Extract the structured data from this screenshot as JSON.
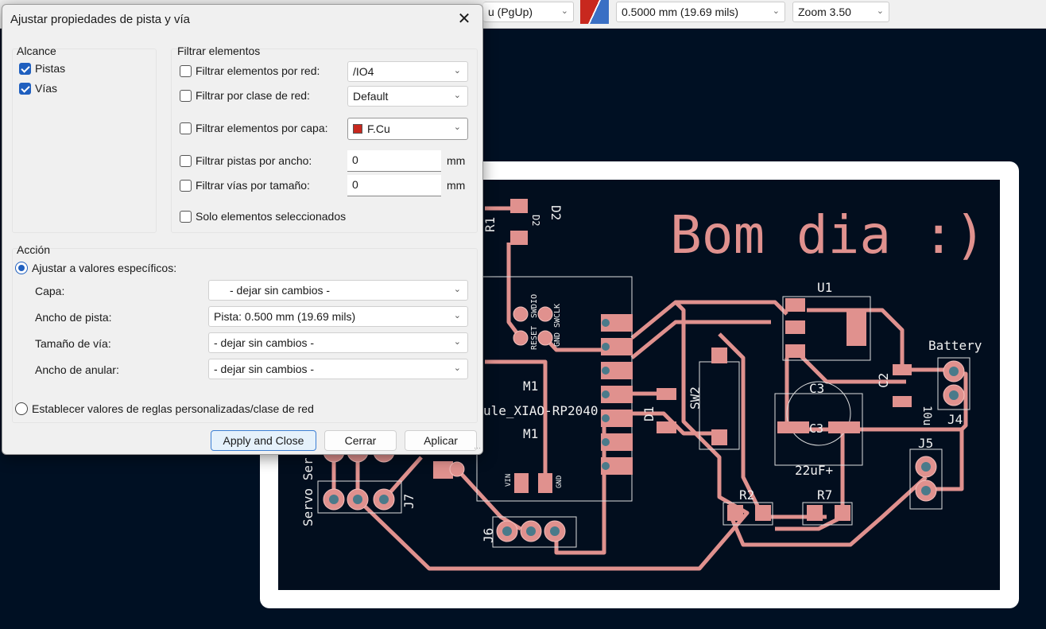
{
  "toolbar": {
    "layer_pair": "u (PgUp)",
    "track_width": "0.5000 mm (19.69 mils)",
    "zoom": "Zoom 3.50",
    "colors": {
      "front": "#c8281e",
      "back": "#3a6fc4"
    }
  },
  "dialog": {
    "title": "Ajustar propiedades de pista y vía",
    "close_icon": "close-icon",
    "scope": {
      "title": "Alcance",
      "tracks": {
        "label": "Pistas",
        "checked": true
      },
      "vias": {
        "label": "Vías",
        "checked": true
      }
    },
    "filter": {
      "title": "Filtrar elementos",
      "by_net": {
        "label": "Filtrar elementos por red:",
        "checked": false,
        "value": "/IO4"
      },
      "by_netclass": {
        "label": "Filtrar por clase de red:",
        "checked": false,
        "value": "Default"
      },
      "by_layer": {
        "label": "Filtrar elementos por capa:",
        "checked": false,
        "value": "F.Cu",
        "color": "#c8281e"
      },
      "by_track_width": {
        "label": "Filtrar pistas por ancho:",
        "checked": false,
        "value": "0",
        "unit": "mm"
      },
      "by_via_size": {
        "label": "Filtrar vías por tamaño:",
        "checked": false,
        "value": "0",
        "unit": "mm"
      },
      "selected_only": {
        "label": "Solo elementos seleccionados",
        "checked": false
      }
    },
    "action": {
      "title": "Acción",
      "set_specific": {
        "label": "Ajustar a valores específicos:",
        "selected": true
      },
      "layer": {
        "label": "Capa:",
        "value": "- dejar sin cambios -"
      },
      "track_width": {
        "label": "Ancho de pista:",
        "value": "Pista: 0.500 mm (19.69 mils)"
      },
      "via_size": {
        "label": "Tamaño de vía:",
        "value": "- dejar sin cambios -"
      },
      "annular": {
        "label": "Ancho de anular:",
        "value": "- dejar sin cambios -"
      },
      "set_netclass": {
        "label": "Establecer valores de reglas personalizadas/clase de red",
        "selected": false
      }
    },
    "buttons": {
      "apply_close": "Apply and Close",
      "close": "Cerrar",
      "apply": "Aplicar"
    }
  },
  "pcb": {
    "text": "Bom dia :)",
    "colors": {
      "background": "#001023",
      "copper": "#e0918e",
      "edge": "#ffffff",
      "silk": "#f0f0f0"
    },
    "refs": {
      "r1": "R1",
      "d2": "D2",
      "d2b": "D2",
      "m1": "M1",
      "m1b": "M1",
      "module": "ule_XIAO-RP2040",
      "u1": "U1",
      "battery": "Battery",
      "c2": "C2",
      "c2v": "10u",
      "c3": "C3",
      "c3b": "C3",
      "c3v": "22uF+",
      "j4": "J4",
      "j5": "J5",
      "j6": "J6",
      "j7": "J7",
      "r2": "R2",
      "r7": "R7",
      "d1": "D1",
      "sw2": "SW2",
      "servo": "Servo Ser",
      "reset": "RESET",
      "swdio": "SWDIO",
      "gnd": "GND",
      "swclk": "SWCLK",
      "vin": "VIN",
      "gnd2": "GND"
    }
  }
}
